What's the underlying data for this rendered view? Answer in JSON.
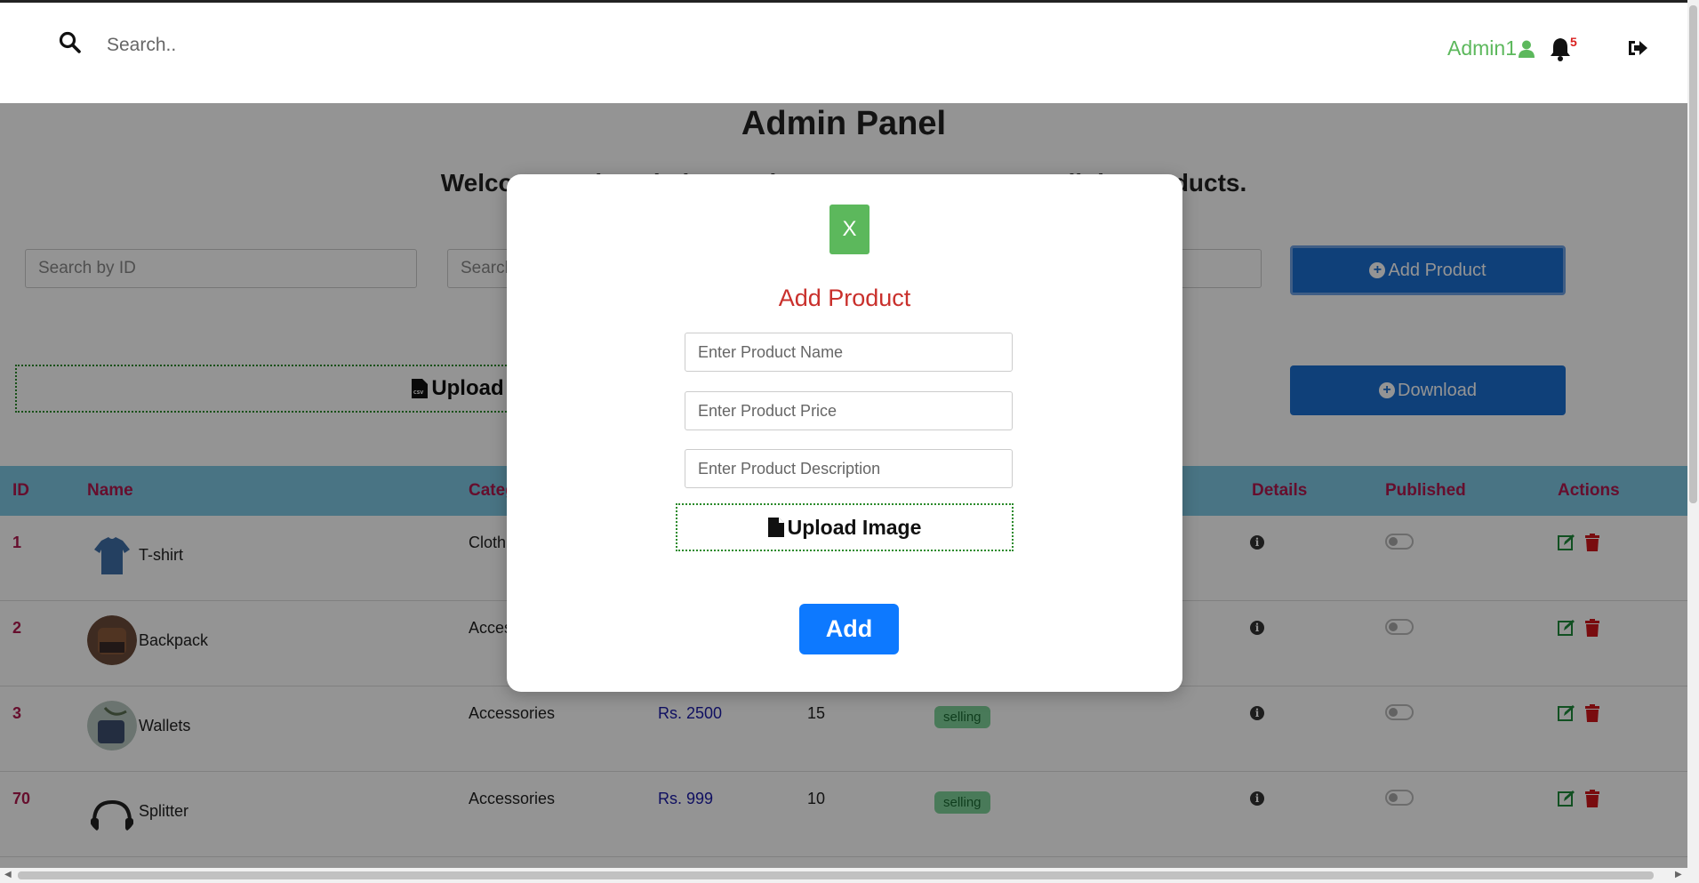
{
  "topnav": {
    "search_placeholder": "Search..",
    "user_label": "Admin1",
    "notification_count": "5"
  },
  "page": {
    "title": "Admin Panel",
    "welcome": "Welcome to the admin panel. Here you can manage all the products."
  },
  "filters": {
    "search_id_placeholder": "Search by ID",
    "search_name_placeholder": "Search by Name",
    "add_product_label": "Add Product",
    "download_label": "Download",
    "upload_csv_label": "Upload CSV File"
  },
  "table": {
    "headers": {
      "id": "ID",
      "name": "Name",
      "category": "Category",
      "details": "Details",
      "published": "Published",
      "actions": "Actions"
    },
    "rows": [
      {
        "id": "1",
        "name": "T-shirt",
        "category": "Clothing",
        "price": "",
        "stock": "",
        "status": ""
      },
      {
        "id": "2",
        "name": "Backpack",
        "category": "Accessories",
        "price": "",
        "stock": "",
        "status": ""
      },
      {
        "id": "3",
        "name": "Wallets",
        "category": "Accessories",
        "price": "Rs. 2500",
        "stock": "15",
        "status": "selling"
      },
      {
        "id": "70",
        "name": "Splitter",
        "category": "Accessories",
        "price": "Rs. 999",
        "stock": "10",
        "status": "selling"
      }
    ]
  },
  "modal": {
    "close_label": "X",
    "title": "Add Product",
    "name_placeholder": "Enter Product Name",
    "price_placeholder": "Enter Product Price",
    "description_placeholder": "Enter Product Description",
    "upload_image_label": "Upload Image",
    "add_label": "Add"
  },
  "colors": {
    "accent_blue": "#1a6fd1",
    "success_green": "#5cb85c",
    "table_header": "#7ec8e3",
    "header_text": "#b0194e",
    "modal_title": "#c9302c",
    "add_button": "#0d79ff"
  }
}
